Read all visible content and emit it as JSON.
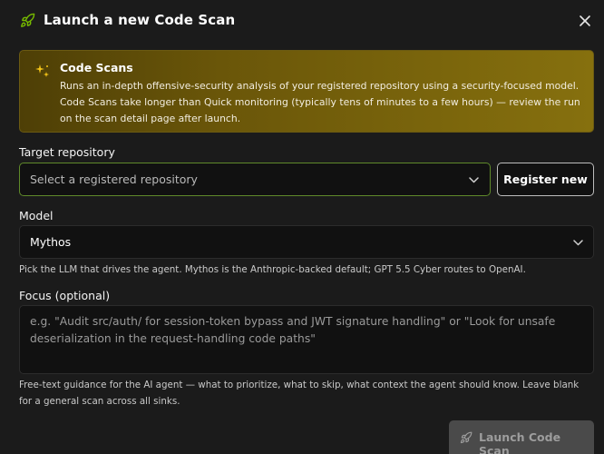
{
  "dialog": {
    "title": "Launch a new Code Scan",
    "icon": "rocket-icon",
    "accent_color": "#76b900"
  },
  "banner": {
    "icon": "sparkle-icon",
    "title": "Code Scans",
    "text": "Runs an in-depth offensive-security analysis of your registered repository using a security-focused model. Code Scans take longer than Quick monitoring (typically tens of minutes to a few hours) — review the run on the scan detail page after launch."
  },
  "target_repository": {
    "label": "Target repository",
    "placeholder": "Select a registered repository",
    "register_button": "Register new"
  },
  "model": {
    "label": "Model",
    "selected": "Mythos",
    "help": "Pick the LLM that drives the agent. Mythos is the Anthropic-backed default; GPT 5.5 Cyber routes to OpenAI."
  },
  "focus": {
    "label": "Focus (optional)",
    "placeholder": "e.g. \"Audit src/auth/ for session-token bypass and JWT signature handling\" or \"Look for unsafe deserialization in the request-handling code paths\"",
    "help": "Free-text guidance for the AI agent — what to prioritize, what to skip, what context the agent should know. Leave blank for a general scan across all sinks."
  },
  "actions": {
    "launch_label": "Launch Code Scan"
  }
}
